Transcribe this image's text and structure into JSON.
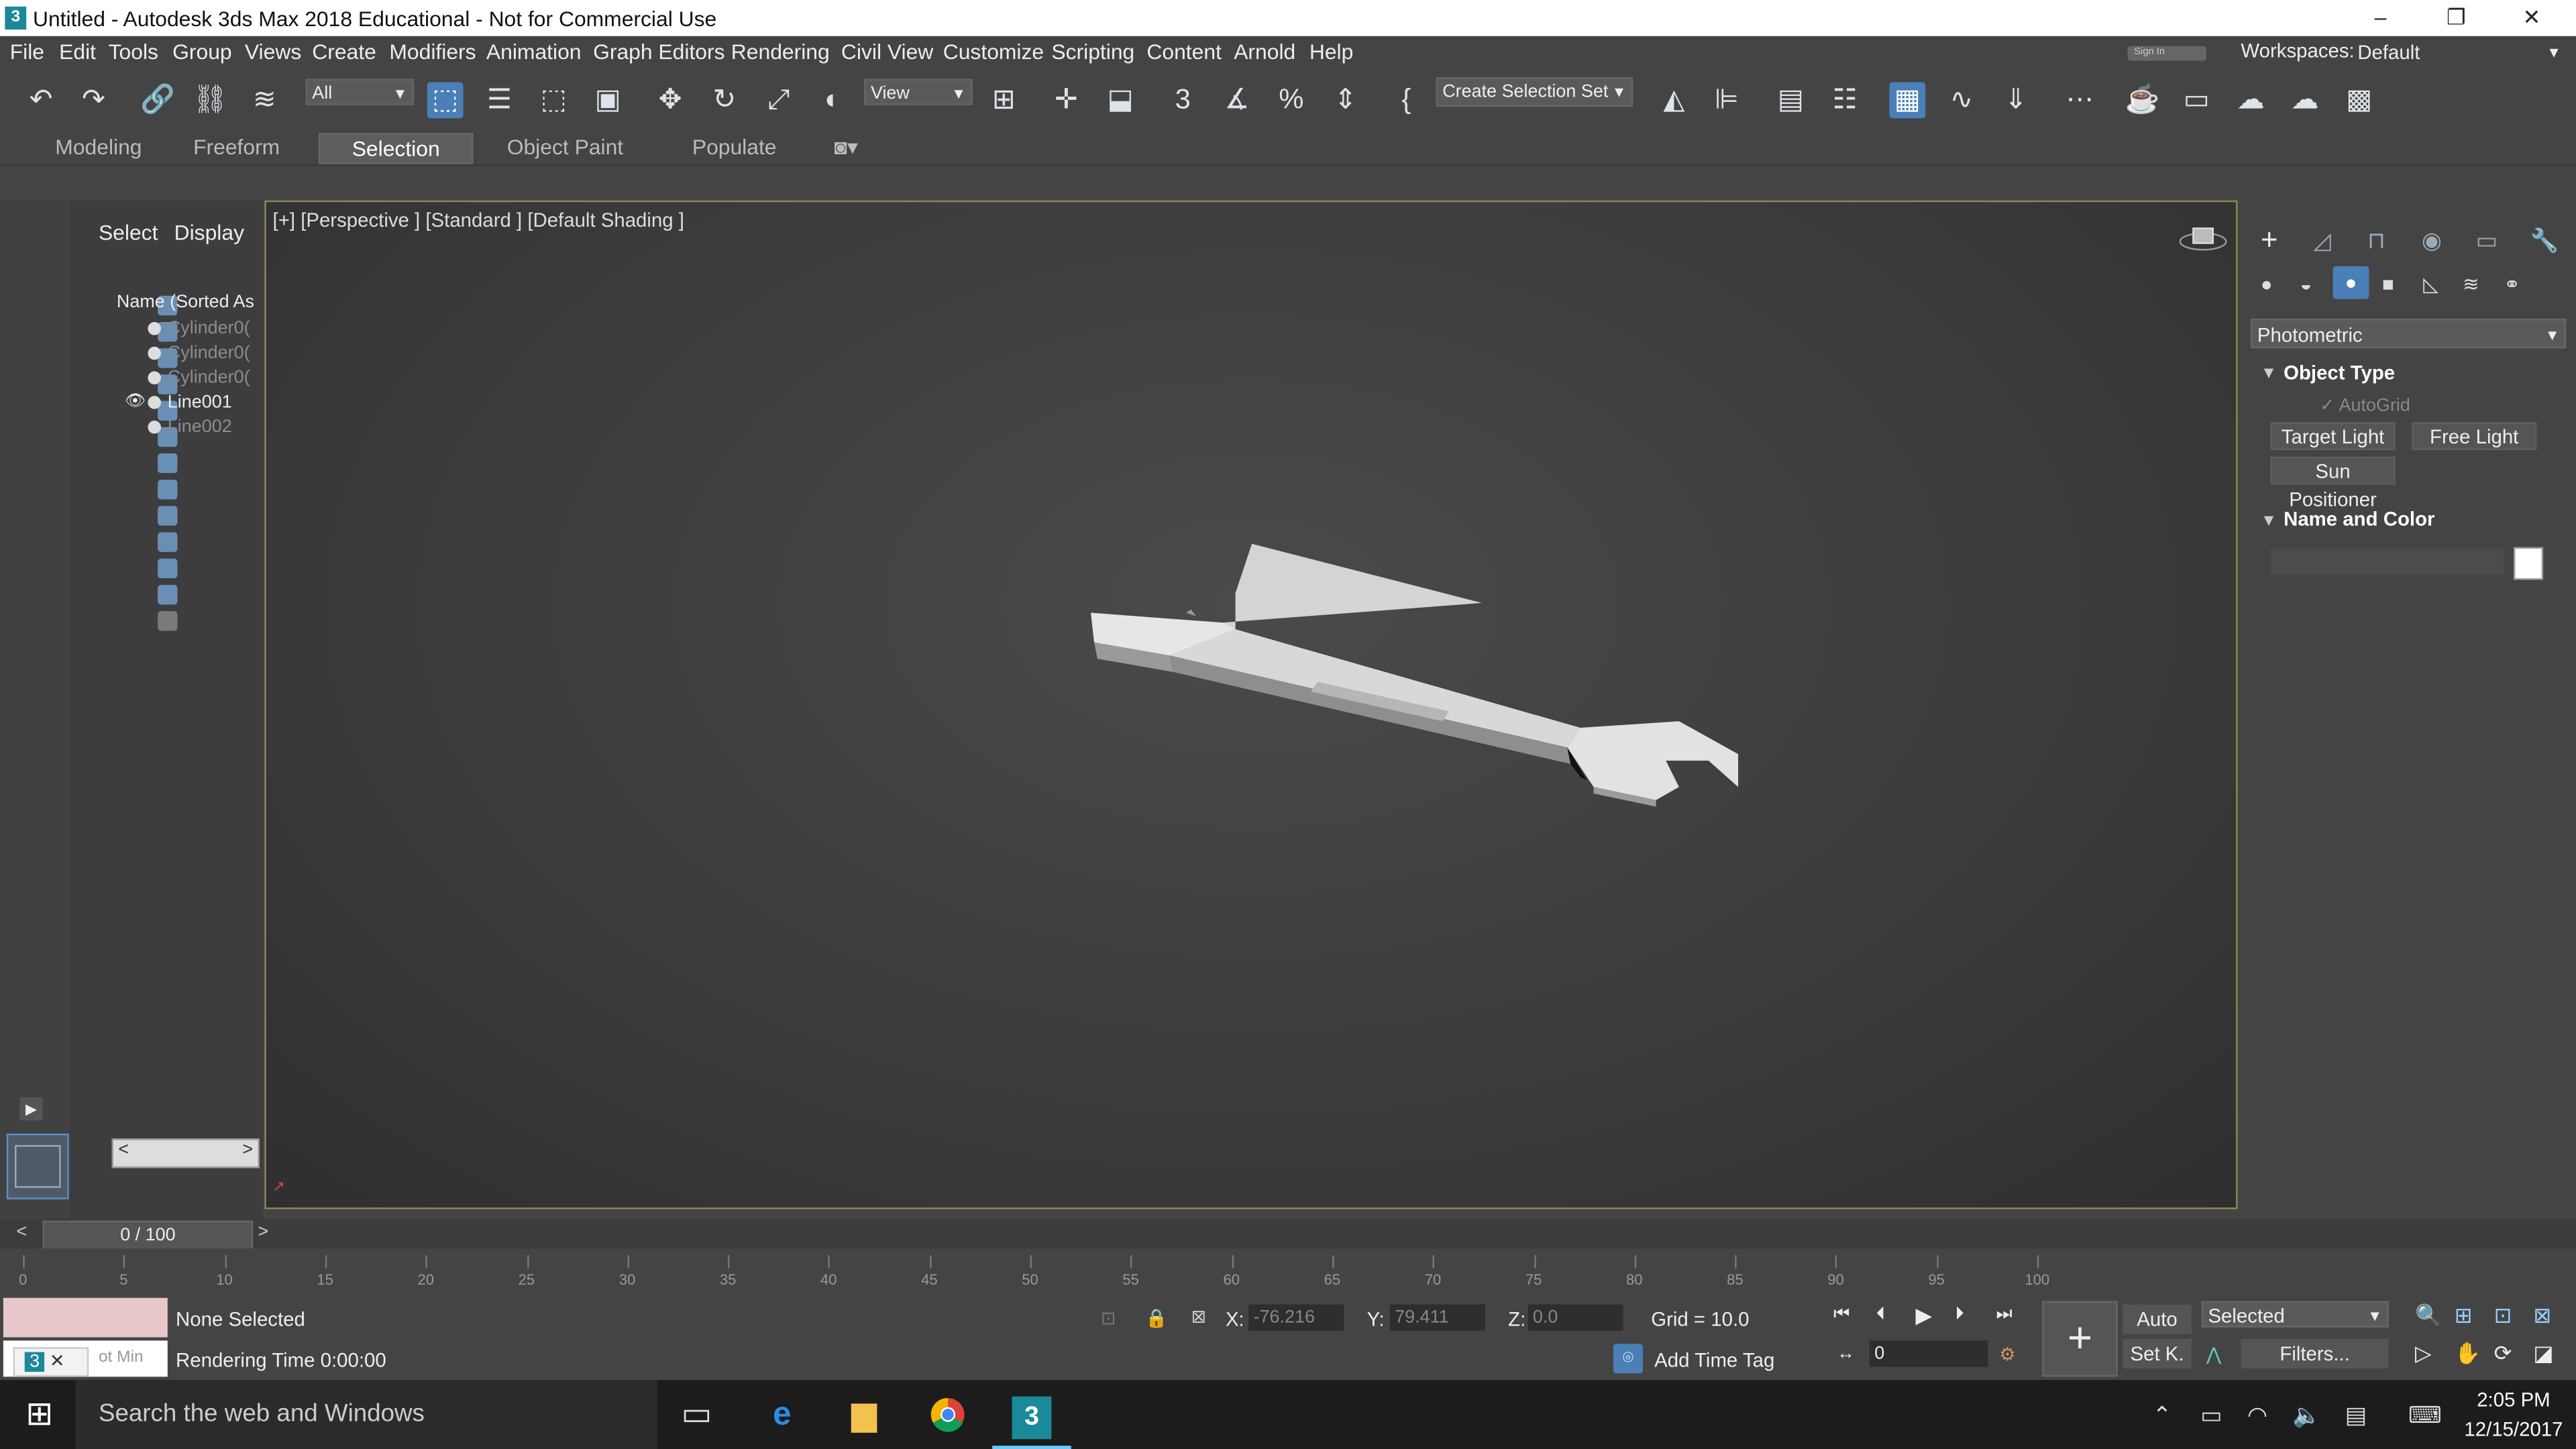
{
  "window": {
    "title": "Untitled - Autodesk 3ds Max 2018 Educational - Not for Commercial Use",
    "app_icon": "3",
    "minimize": "–",
    "restore": "❐",
    "close": "✕"
  },
  "menu": {
    "items": [
      "File",
      "Edit",
      "Tools",
      "Group",
      "Views",
      "Create",
      "Modifiers",
      "Animation",
      "Graph Editors",
      "Rendering",
      "Civil View",
      "Customize",
      "Scripting",
      "Content",
      "Arnold",
      "Help"
    ],
    "signin": "Sign In",
    "workspaces_label": "Workspaces:",
    "workspaces_value": "Default"
  },
  "toolbar": {
    "filter_value": "All",
    "refcoord_value": "View",
    "selection_set_value": "Create Selection Set",
    "snap_label": "3",
    "angle_snap": "∡",
    "percent": "%"
  },
  "ribbon": {
    "tabs": [
      "Modeling",
      "Freeform",
      "Selection",
      "Object Paint",
      "Populate"
    ],
    "active_tab": "Selection"
  },
  "scene_explorer": {
    "tabs": [
      "Select",
      "Display"
    ],
    "column_header": "Name (Sorted As",
    "items": [
      {
        "name": "Cylinder0(",
        "visible": false
      },
      {
        "name": "Cylinder0(",
        "visible": false
      },
      {
        "name": "Cylinder0(",
        "visible": false
      },
      {
        "name": "Line001",
        "visible": true
      },
      {
        "name": "Line002",
        "visible": false
      }
    ]
  },
  "viewport": {
    "label": "[+] [Perspective ]  [Standard ]  [Default Shading ]"
  },
  "command_panel": {
    "dropdown": "Photometric",
    "object_type_title": "Object Type",
    "autogrid": "AutoGrid",
    "buttons": [
      "Target Light",
      "Free Light",
      "Sun Positioner"
    ],
    "name_color_title": "Name and Color",
    "color_swatch": "#ffffff"
  },
  "time_slider": {
    "value": "0 / 100",
    "prev": "<",
    "next": ">"
  },
  "trackbar": {
    "ticks": [
      "0",
      "5",
      "10",
      "15",
      "20",
      "25",
      "30",
      "35",
      "40",
      "45",
      "50",
      "55",
      "60",
      "65",
      "70",
      "75",
      "80",
      "85",
      "90",
      "95",
      "100"
    ]
  },
  "status": {
    "selection": "None Selected",
    "rendering_time": "Rendering Time  0:00:00",
    "script_hint": "ot Min",
    "x_label": "X:",
    "x_value": "-76.216",
    "y_label": "Y:",
    "y_value": "79.411",
    "z_label": "Z:",
    "z_value": "0.0",
    "grid": "Grid = 10.0",
    "add_time_tag": "Add Time Tag",
    "auto": "Auto",
    "set_key": "Set K.",
    "key_dropdown": "Selected",
    "filters": "Filters...",
    "frame_value": "0"
  },
  "taskbar": {
    "search_placeholder": "Search the web and Windows",
    "time": "2:05 PM",
    "date": "12/15/2017"
  }
}
